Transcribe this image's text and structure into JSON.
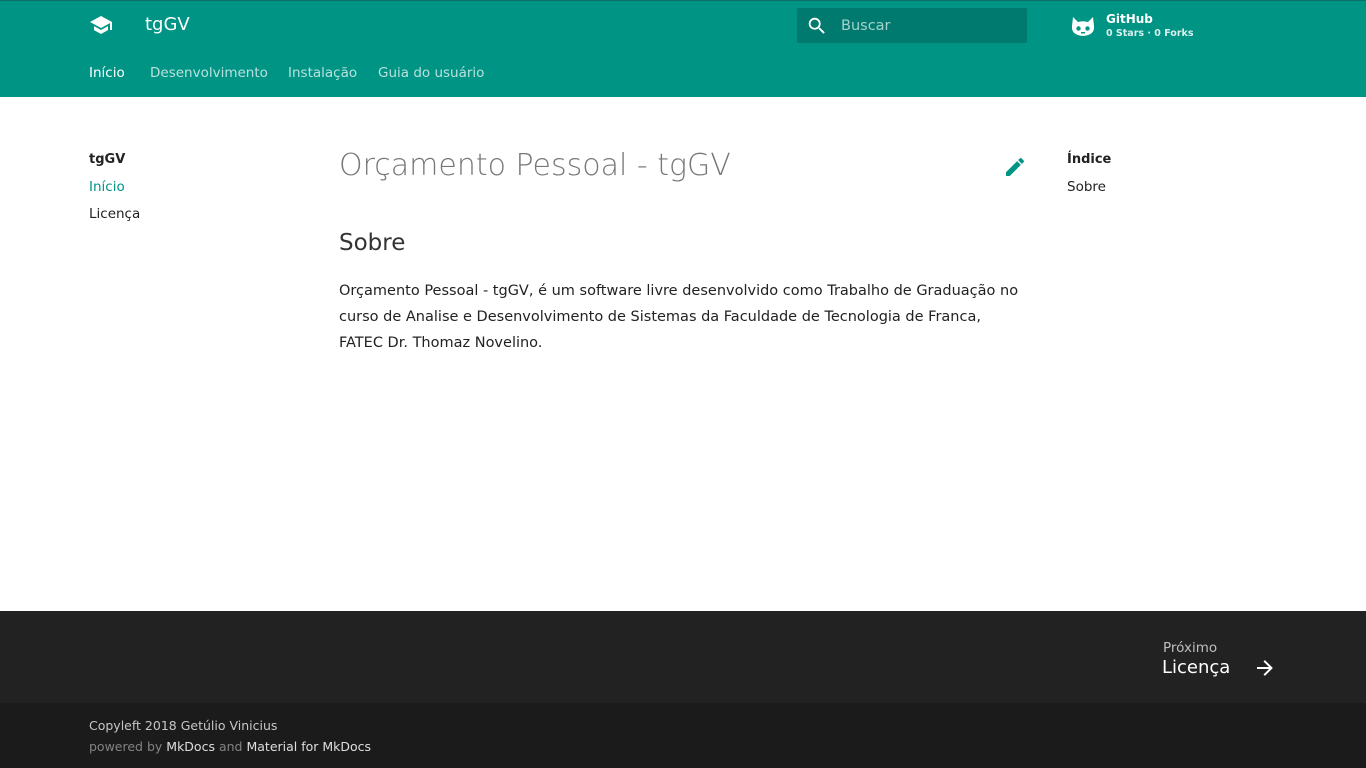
{
  "header": {
    "site_title": "tgGV",
    "logo_icon": "graduation-cap-icon",
    "search": {
      "placeholder": "Buscar",
      "value": ""
    },
    "repo": {
      "name": "GitHub",
      "facts": "0 Stars · 0 Forks",
      "icon": "github-octocat-icon"
    }
  },
  "tabs": [
    {
      "label": "Início",
      "active": true
    },
    {
      "label": "Desenvolvimento",
      "active": false
    },
    {
      "label": "Instalação",
      "active": false
    },
    {
      "label": "Guia do usuário",
      "active": false
    }
  ],
  "sidebar": {
    "title": "tgGV",
    "items": [
      {
        "label": "Início",
        "active": true
      },
      {
        "label": "Licença",
        "active": false
      }
    ]
  },
  "main": {
    "title": "Orçamento Pessoal - tgGV",
    "edit_icon": "pencil-icon",
    "section_heading": "Sobre",
    "paragraph": "Orçamento Pessoal - tgGV, é um software livre desenvolvido como Trabalho de Graduação no curso de Analise e Desenvolvimento de Sistemas da Faculdade de Tecnologia de Franca, FATEC Dr. Thomaz Novelino."
  },
  "toc": {
    "title": "Índice",
    "items": [
      {
        "label": "Sobre"
      }
    ]
  },
  "footer": {
    "next_direction": "Próximo",
    "next_title": "Licença",
    "copyright": "Copyleft 2018 Getúlio Vinicius",
    "powered_prefix": "powered by",
    "mkdocs": "MkDocs",
    "and": "and",
    "material": "Material for MkDocs"
  },
  "colors": {
    "primary": "#009485",
    "search_bg": "#007a6e",
    "footer_nav_bg": "#222222",
    "footer_meta_bg": "#1b1b1b"
  }
}
